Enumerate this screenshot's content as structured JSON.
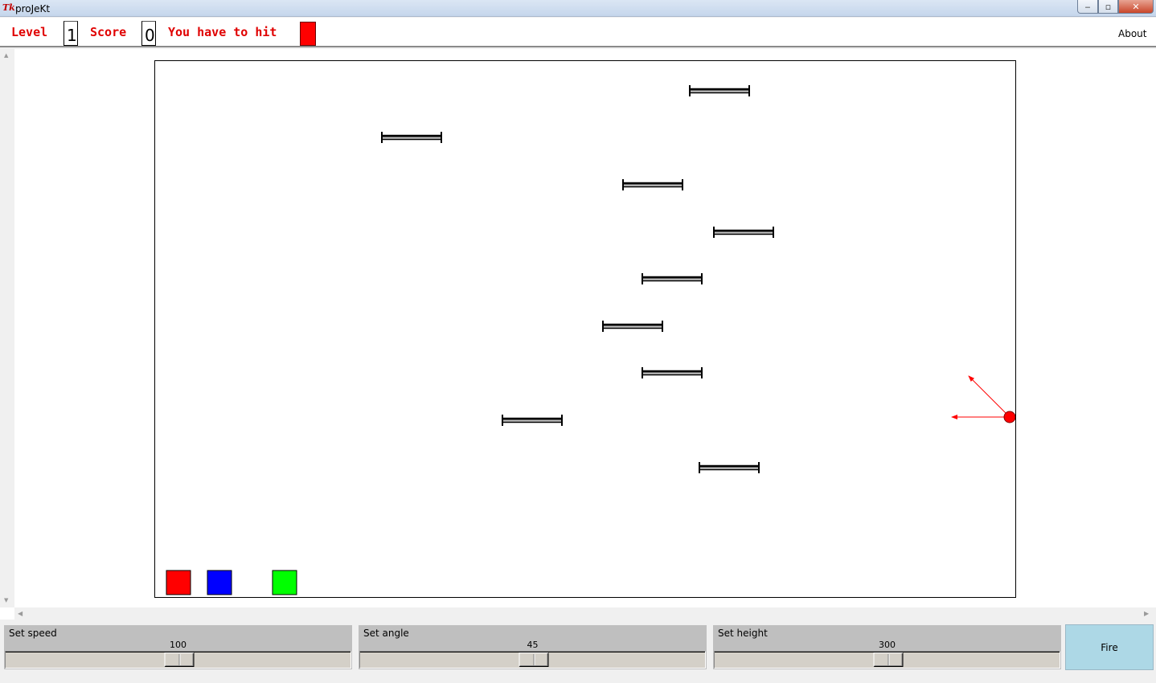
{
  "window": {
    "logo": "Tk",
    "title": "proJeKt",
    "minimize": "‒",
    "maximize": "▫",
    "close": "✕"
  },
  "header": {
    "level_label": "Level",
    "level_value": "1",
    "score_label": "Score",
    "score_value": "0",
    "hit_label": "You have to hit",
    "hit_color": "#ff0000",
    "about_label": "About"
  },
  "canvas": {
    "platform_count": 9,
    "launcher_color": "#ff0000",
    "color_targets": [
      {
        "name": "red-target",
        "color": "#ff0000"
      },
      {
        "name": "blue-target",
        "color": "#0000ff"
      },
      {
        "name": "green-target",
        "color": "#00ff00"
      }
    ]
  },
  "controls": {
    "speed": {
      "label": "Set speed",
      "value": "100",
      "min": 0,
      "max": 200
    },
    "angle": {
      "label": "Set angle",
      "value": "45",
      "min": -45,
      "max": 135
    },
    "height": {
      "label": "Set height",
      "value": "300",
      "min": 0,
      "max": 600
    },
    "fire_label": "Fire"
  },
  "icons": {
    "scroll_up": "▲",
    "scroll_down": "▼",
    "scroll_left": "◀",
    "scroll_right": "▶"
  }
}
